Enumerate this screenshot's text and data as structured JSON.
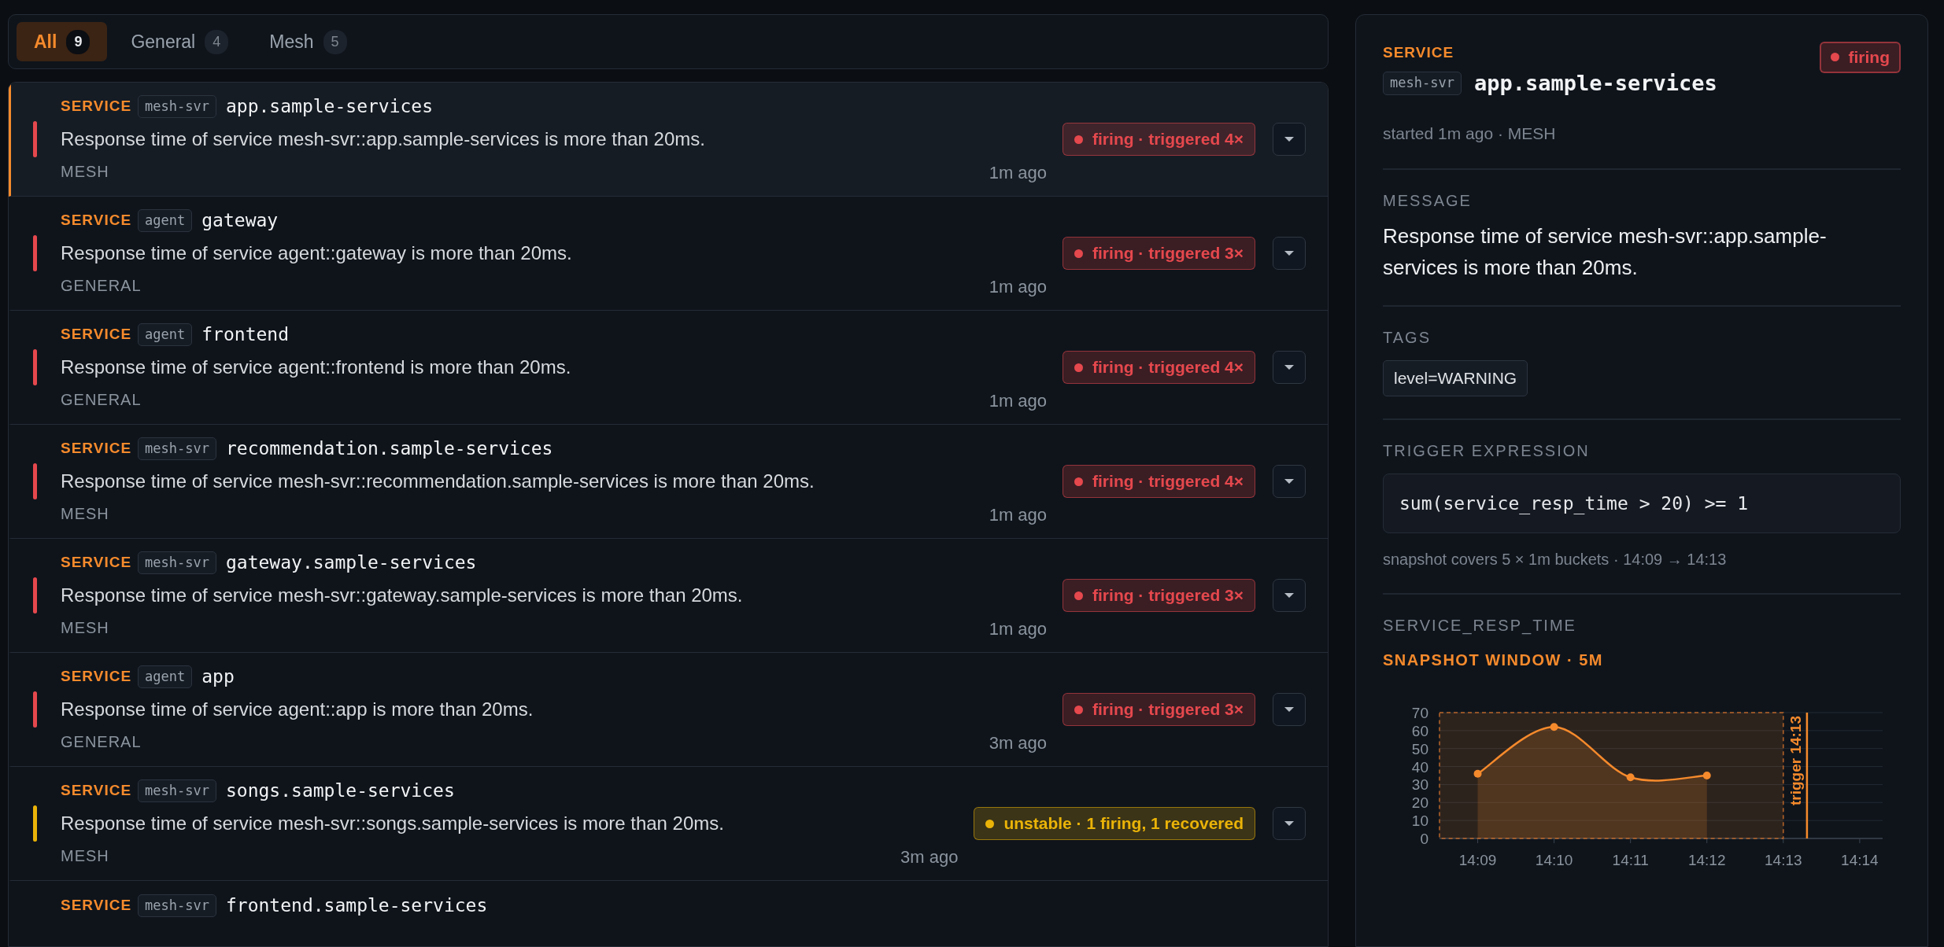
{
  "tabs": [
    {
      "label": "All",
      "count": "9",
      "selected": true
    },
    {
      "label": "General",
      "count": "4",
      "selected": false
    },
    {
      "label": "Mesh",
      "count": "5",
      "selected": false
    }
  ],
  "alerts": [
    {
      "category": "SERVICE",
      "scope": "mesh-svr",
      "name": "app.sample-services",
      "message": "Response time of service mesh-svr::app.sample-services is more than 20ms.",
      "group": "MESH",
      "time": "1m ago",
      "color": "#e5484d",
      "status_text": "firing · triggered 4×",
      "selected": true
    },
    {
      "category": "SERVICE",
      "scope": "agent",
      "name": "gateway",
      "message": "Response time of service agent::gateway is more than 20ms.",
      "group": "GENERAL",
      "time": "1m ago",
      "color": "#e5484d",
      "status_text": "firing · triggered 3×",
      "selected": false
    },
    {
      "category": "SERVICE",
      "scope": "agent",
      "name": "frontend",
      "message": "Response time of service agent::frontend is more than 20ms.",
      "group": "GENERAL",
      "time": "1m ago",
      "color": "#e5484d",
      "status_text": "firing · triggered 4×",
      "selected": false
    },
    {
      "category": "SERVICE",
      "scope": "mesh-svr",
      "name": "recommendation.sample-services",
      "message": "Response time of service mesh-svr::recommendation.sample-services is more than 20ms.",
      "group": "MESH",
      "time": "1m ago",
      "color": "#e5484d",
      "status_text": "firing · triggered 4×",
      "selected": false
    },
    {
      "category": "SERVICE",
      "scope": "mesh-svr",
      "name": "gateway.sample-services",
      "message": "Response time of service mesh-svr::gateway.sample-services is more than 20ms.",
      "group": "MESH",
      "time": "1m ago",
      "color": "#e5484d",
      "status_text": "firing · triggered 3×",
      "selected": false
    },
    {
      "category": "SERVICE",
      "scope": "agent",
      "name": "app",
      "message": "Response time of service agent::app is more than 20ms.",
      "group": "GENERAL",
      "time": "3m ago",
      "color": "#e5484d",
      "status_text": "firing · triggered 3×",
      "selected": false
    },
    {
      "category": "SERVICE",
      "scope": "mesh-svr",
      "name": "songs.sample-services",
      "message": "Response time of service mesh-svr::songs.sample-services is more than 20ms.",
      "group": "MESH",
      "time": "3m ago",
      "color": "#eab308",
      "status_text": "unstable · 1 firing, 1 recovered",
      "selected": false
    },
    {
      "category": "SERVICE",
      "scope": "mesh-svr",
      "name": "frontend.sample-services",
      "selected": false
    }
  ],
  "detail": {
    "category": "SERVICE",
    "scope": "mesh-svr",
    "name": "app.sample-services",
    "color": "#e5484d",
    "status_text": "firing",
    "meta": "started 1m ago · MESH",
    "message_label": "MESSAGE",
    "message": "Response time of service mesh-svr::app.sample-services is more than 20ms.",
    "tags_label": "TAGS",
    "tags": [
      "level=WARNING"
    ],
    "expression_label": "TRIGGER EXPRESSION",
    "expression": "sum(service_resp_time > 20) >= 1",
    "snapshot_note": "snapshot covers 5 × 1m buckets · 14:09 → 14:13",
    "metric_label": "SERVICE_RESP_TIME",
    "chart_data": {
      "type": "area",
      "title": "SNAPSHOT WINDOW · 5M",
      "x": [
        "14:09",
        "14:10",
        "14:11",
        "14:12",
        "14:13",
        "14:14"
      ],
      "series": [
        {
          "color": "#f58a2c",
          "values": [
            36,
            62,
            34,
            35,
            null,
            null
          ]
        }
      ],
      "ylim": [
        0,
        70
      ],
      "yticks": [
        0,
        10,
        20,
        30,
        40,
        50,
        60,
        70
      ],
      "grid": true,
      "bands": [
        {
          "axis": "x",
          "from": "14:09",
          "to": "14:13"
        }
      ],
      "ref_lines": [
        {
          "axis": "x",
          "value": "14:13",
          "label": "trigger 14:13"
        }
      ]
    }
  }
}
